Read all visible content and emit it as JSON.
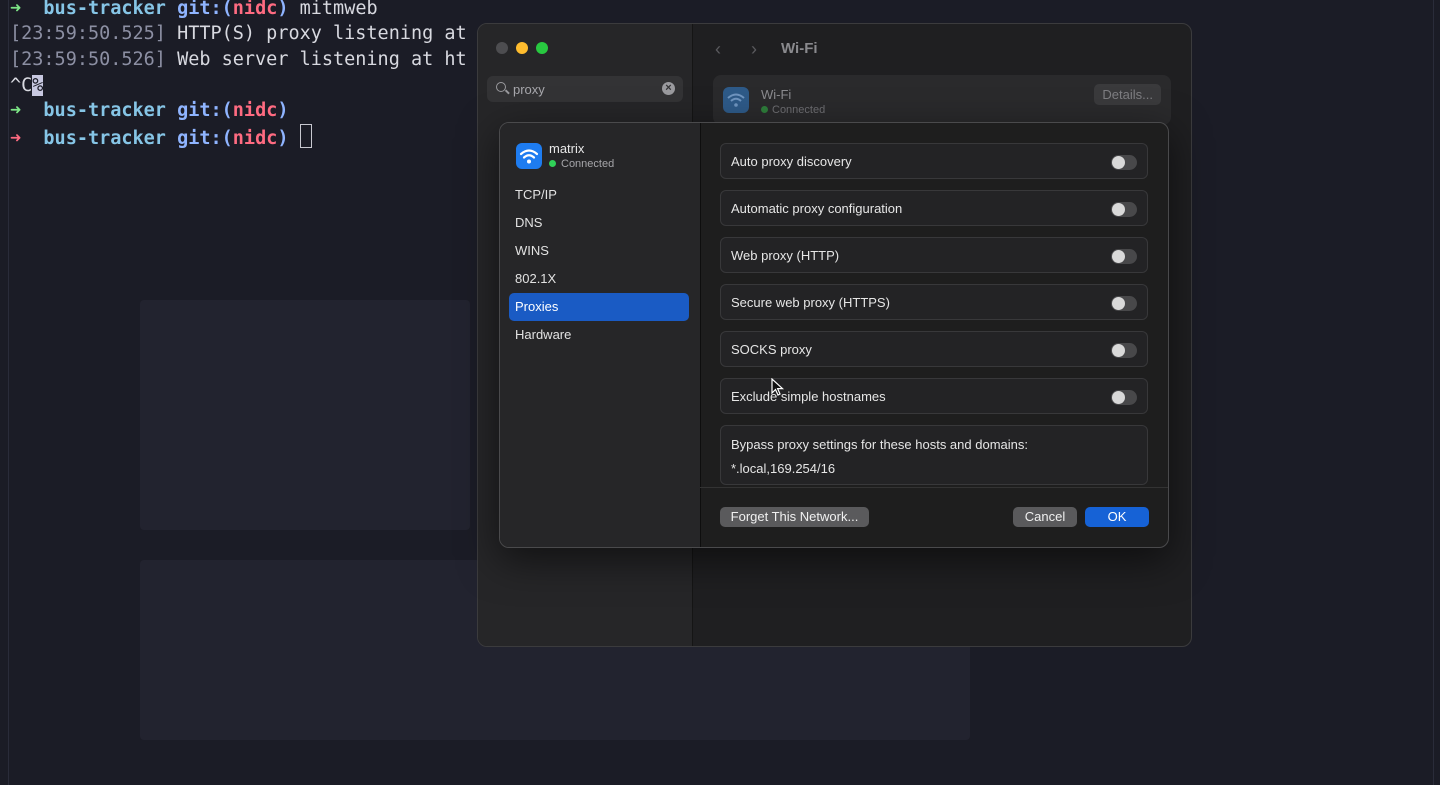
{
  "terminal": {
    "lines": [
      {
        "arrow": "➜",
        "dir": "bus-tracker",
        "git": "git:(",
        "branch": "nidc",
        "git_close": ")",
        "cmd": "mitmweb"
      },
      {
        "ts": "[23:59:50.525]",
        "msg": "HTTP(S) proxy listening at"
      },
      {
        "ts": "[23:59:50.526]",
        "msg": "Web server listening at ht"
      },
      {
        "text_a": "^C",
        "text_b": "%"
      },
      {
        "arrow": "➜",
        "dir": "bus-tracker",
        "git": "git:(",
        "branch": "nidc",
        "git_close": ")"
      },
      {
        "arrow": "➜",
        "dir": "bus-tracker",
        "git": "git:(",
        "branch": "nidc",
        "git_close": ")"
      }
    ]
  },
  "settings": {
    "search_value": "proxy",
    "title": "Wi-Fi",
    "back_icon": "chevron-left-icon",
    "forward_icon": "chevron-right-icon",
    "wifi_card": {
      "name": "Wi-Fi",
      "status": "Connected",
      "details_label": "Details..."
    }
  },
  "sheet": {
    "network": {
      "name": "matrix",
      "status": "Connected",
      "icon": "wifi-icon"
    },
    "sidebar": [
      {
        "label": "TCP/IP",
        "active": false
      },
      {
        "label": "DNS",
        "active": false
      },
      {
        "label": "WINS",
        "active": false
      },
      {
        "label": "802.1X",
        "active": false
      },
      {
        "label": "Proxies",
        "active": true
      },
      {
        "label": "Hardware",
        "active": false
      }
    ],
    "options": [
      {
        "label": "Auto proxy discovery",
        "on": false
      },
      {
        "label": "Automatic proxy configuration",
        "on": false
      },
      {
        "label": "Web proxy (HTTP)",
        "on": false
      },
      {
        "label": "Secure web proxy (HTTPS)",
        "on": false
      },
      {
        "label": "SOCKS proxy",
        "on": false
      },
      {
        "label": "Exclude simple hostnames",
        "on": false
      }
    ],
    "bypass": {
      "label": "Bypass proxy settings for these hosts and domains:",
      "value": "*.local,169.254/16"
    },
    "buttons": {
      "forget": "Forget This Network...",
      "cancel": "Cancel",
      "ok": "OK"
    }
  },
  "colors": {
    "accent": "#1662d6",
    "selected": "#1a5bc4",
    "connected": "#30d158"
  }
}
